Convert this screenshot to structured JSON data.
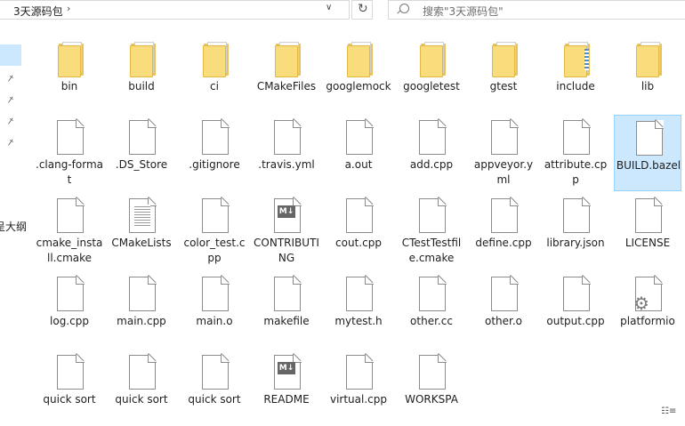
{
  "window": {
    "breadcrumb": "3天源码包",
    "search_placeholder": "搜索\"3天源码包\"",
    "refresh_icon": "refresh-icon",
    "nav_partial_text": "呈大纲"
  },
  "items": [
    {
      "label": "bin",
      "type": "folder"
    },
    {
      "label": "build",
      "type": "folder"
    },
    {
      "label": "ci",
      "type": "folder"
    },
    {
      "label": "CMakeFiles",
      "type": "folder"
    },
    {
      "label": "googlemock",
      "type": "folder"
    },
    {
      "label": "googletest",
      "type": "folder"
    },
    {
      "label": "gtest",
      "type": "folder"
    },
    {
      "label": "include",
      "type": "folder"
    },
    {
      "label": "lib",
      "type": "folder"
    },
    {
      "label": ".clang-format",
      "type": "file"
    },
    {
      "label": ".DS_Store",
      "type": "file"
    },
    {
      "label": ".gitignore",
      "type": "file"
    },
    {
      "label": ".travis.yml",
      "type": "file"
    },
    {
      "label": "a.out",
      "type": "file"
    },
    {
      "label": "add.cpp",
      "type": "file"
    },
    {
      "label": "appveyor.yml",
      "type": "file"
    },
    {
      "label": "attribute.cpp",
      "type": "file"
    },
    {
      "label": "BUILD.bazel",
      "type": "file",
      "selected": true
    },
    {
      "label": "cmake_install.cmake",
      "type": "file"
    },
    {
      "label": "CMakeLists",
      "type": "text"
    },
    {
      "label": "color_test.cpp",
      "type": "file"
    },
    {
      "label": "CONTRIBUTING",
      "type": "markdown"
    },
    {
      "label": "cout.cpp",
      "type": "file"
    },
    {
      "label": "CTestTestfile.cmake",
      "type": "file"
    },
    {
      "label": "define.cpp",
      "type": "file"
    },
    {
      "label": "library.json",
      "type": "file"
    },
    {
      "label": "LICENSE",
      "type": "file"
    },
    {
      "label": "log.cpp",
      "type": "file"
    },
    {
      "label": "main.cpp",
      "type": "file"
    },
    {
      "label": "main.o",
      "type": "file"
    },
    {
      "label": "makefile",
      "type": "file"
    },
    {
      "label": "mytest.h",
      "type": "file"
    },
    {
      "label": "other.cc",
      "type": "file"
    },
    {
      "label": "other.o",
      "type": "file"
    },
    {
      "label": "output.cpp",
      "type": "file"
    },
    {
      "label": "platformio",
      "type": "settings"
    },
    {
      "label": "quick sort",
      "type": "file"
    },
    {
      "label": "quick sort",
      "type": "file"
    },
    {
      "label": "quick sort",
      "type": "file"
    },
    {
      "label": "README",
      "type": "markdown"
    },
    {
      "label": "virtual.cpp",
      "type": "file"
    },
    {
      "label": "WORKSPA",
      "type": "file"
    }
  ]
}
